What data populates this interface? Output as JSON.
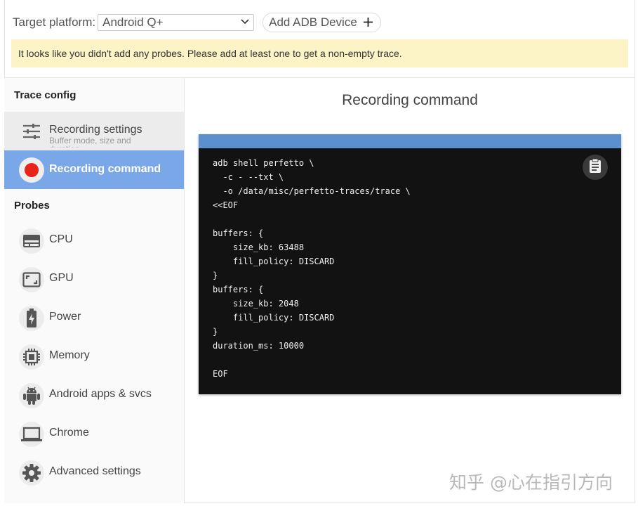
{
  "topbar": {
    "target_label": "Target platform:",
    "target_value": "Android Q+",
    "add_device_label": "Add ADB Device"
  },
  "warning": {
    "text": "It looks like you didn't add any probes. Please add at least one to get a non-empty trace."
  },
  "sidebar": {
    "trace_config_heading": "Trace config",
    "recording_settings": {
      "label": "Recording settings",
      "sublabel": "Buffer mode, size and duration",
      "icon": "sliders-icon"
    },
    "recording_command": {
      "label": "Recording command",
      "icon": "record-dot-icon"
    },
    "probes_heading": "Probes",
    "probes": [
      {
        "label": "CPU",
        "icon": "cpu-panel-icon"
      },
      {
        "label": "GPU",
        "icon": "gpu-frame-icon"
      },
      {
        "label": "Power",
        "icon": "battery-charging-icon"
      },
      {
        "label": "Memory",
        "icon": "memory-chip-icon"
      },
      {
        "label": "Android apps & svcs",
        "icon": "android-icon"
      },
      {
        "label": "Chrome",
        "icon": "laptop-icon"
      },
      {
        "label": "Advanced settings",
        "icon": "gear-icon"
      }
    ]
  },
  "main": {
    "title": "Recording command",
    "command": "adb shell perfetto \\\n  -c - --txt \\\n  -o /data/misc/perfetto-traces/trace \\\n<<EOF\n\nbuffers: {\n    size_kb: 63488\n    fill_policy: DISCARD\n}\nbuffers: {\n    size_kb: 2048\n    fill_policy: DISCARD\n}\nduration_ms: 10000\n\nEOF",
    "copy_icon": "clipboard-icon"
  },
  "watermark": "知乎 @心在指引方向",
  "colors": {
    "active_nav": "#7aa7e8",
    "warning_bg": "#fcf3c6",
    "code_header": "#5c8fce",
    "code_bg": "#121212",
    "record_dot": "#e8231c"
  }
}
